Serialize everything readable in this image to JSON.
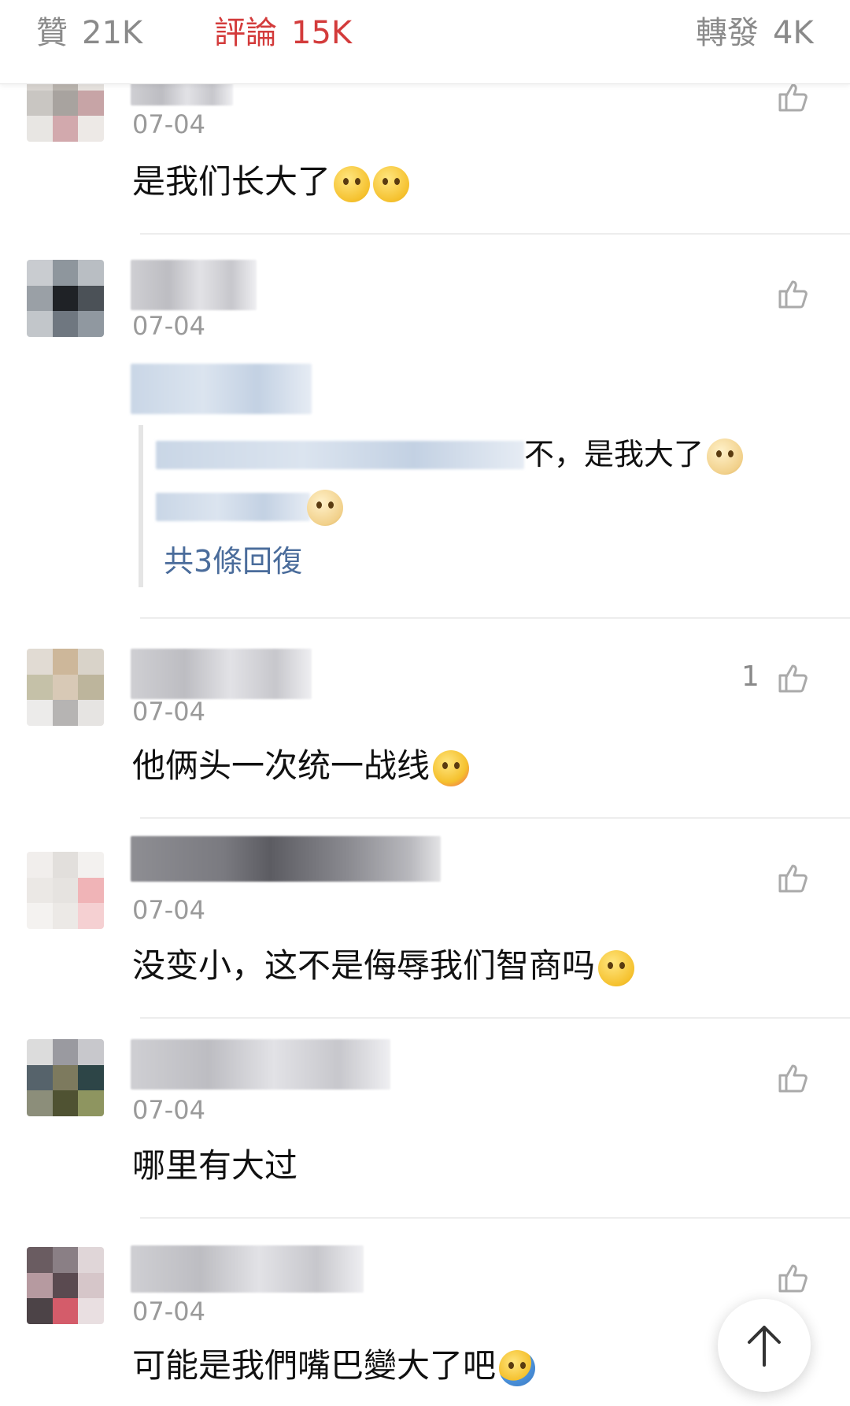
{
  "tabs": {
    "like": {
      "label": "贊",
      "count": "21K"
    },
    "comment": {
      "label": "評論",
      "count": "15K"
    },
    "repost": {
      "label": "轉發",
      "count": "4K"
    }
  },
  "comments": [
    {
      "date": "07-04",
      "text": "是我们长大了",
      "emoji": [
        "flushed-face-icon",
        "flushed-face-icon"
      ],
      "likes": ""
    },
    {
      "date": "07-04",
      "text": "",
      "likes": "",
      "replies": {
        "line1_text": "不，是我大了",
        "more_label": "共3條回復"
      }
    },
    {
      "date": "07-04",
      "text": "他俩头一次统一战线",
      "emoji": [
        "heart-hug-face-icon"
      ],
      "likes": "1"
    },
    {
      "date": "07-04",
      "text": "没变小，这不是侮辱我们智商吗",
      "emoji": [
        "smirk-face-icon"
      ],
      "likes": ""
    },
    {
      "date": "07-04",
      "text": "哪里有大过",
      "likes": ""
    },
    {
      "date": "07-04",
      "text": "可能是我們嘴巴變大了吧",
      "emoji": [
        "shrug-icon"
      ],
      "likes": ""
    }
  ],
  "colors": {
    "accent": "#d33b3b",
    "link": "#4a6c9b",
    "muted": "#9a9a9a"
  }
}
